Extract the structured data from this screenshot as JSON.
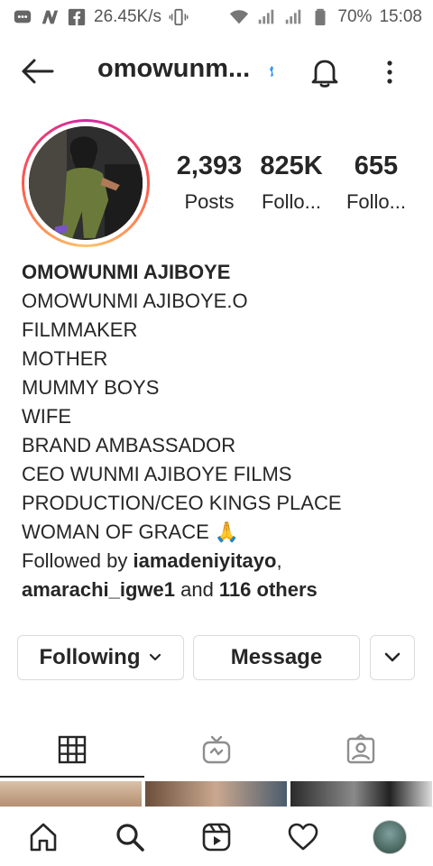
{
  "status_bar": {
    "speed": "26.45K/s",
    "battery": "70%",
    "time": "15:08"
  },
  "header": {
    "username": "omowunm..."
  },
  "profile": {
    "stats": [
      {
        "value": "2,393",
        "label": "Posts"
      },
      {
        "value": "825K",
        "label": "Follo..."
      },
      {
        "value": "655",
        "label": "Follo..."
      }
    ],
    "bio": {
      "name": "OMOWUNMI AJIBOYE",
      "lines": [
        "OMOWUNMI AJIBOYE.O",
        "FILMMAKER",
        "MOTHER",
        "MUMMY BOYS",
        "WIFE",
        "BRAND AMBASSADOR",
        "CEO WUNMI AJIBOYE FILMS",
        "PRODUCTION/CEO KINGS PLACE",
        "WOMAN OF GRACE 🙏"
      ],
      "followed_by_prefix": "Followed by ",
      "followed_by_user1": "iamadeniyitayo",
      "followed_by_sep": ",",
      "followed_by_user2": "amarachi_igwe1",
      "followed_by_and": " and ",
      "followed_by_others": "116 others"
    }
  },
  "actions": {
    "following_label": "Following",
    "message_label": "Message"
  },
  "tabs": [
    {
      "icon": "grid-icon",
      "active": true
    },
    {
      "icon": "igtv-icon",
      "active": false
    },
    {
      "icon": "tagged-icon",
      "active": false
    }
  ],
  "bottom_nav": [
    {
      "icon": "home-icon"
    },
    {
      "icon": "search-icon"
    },
    {
      "icon": "reels-icon"
    },
    {
      "icon": "heart-icon"
    },
    {
      "icon": "profile-avatar"
    }
  ],
  "colors": {
    "text": "#262626",
    "border": "#dbdbdb",
    "ring_start": "#d6249f",
    "ring_end": "#fdc468",
    "verified": "#3897f0"
  }
}
